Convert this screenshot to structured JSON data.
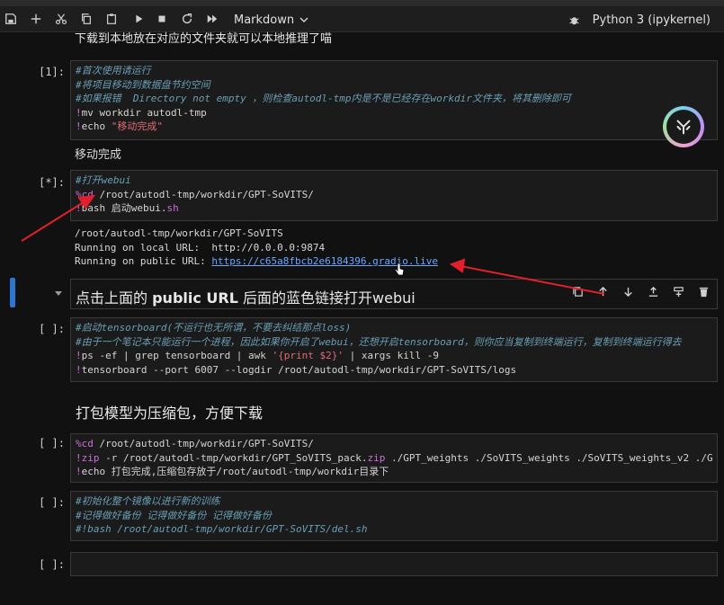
{
  "colors": {
    "accent": "#2a78d4",
    "annotation_arrow": "#e0202a",
    "link": "#6aa7ff"
  },
  "toolbar": {
    "icons": [
      "save-icon",
      "add-cell-icon",
      "cut-icon",
      "copy-icon",
      "paste-icon",
      "run-icon",
      "stop-icon",
      "restart-icon",
      "run-all-icon"
    ],
    "cell_type": "Markdown",
    "kernel": "Python 3 (ipykernel)"
  },
  "top_text": "下载到本地放在对应的文件夹就可以本地推理了喵",
  "cells": {
    "c1": {
      "prompt": "[1]:",
      "line1": "#首次使用请运行",
      "line2": "#将项目移动到数据盘节约空间",
      "line3": "#如果报错  Directory not empty ，则检查autodl-tmp内是不是已经存在workdir文件夹，将其删除即可",
      "line4_bang": "!",
      "line4": "mv workdir autodl-tmp",
      "line5_bang": "!",
      "line5_cmd": "echo ",
      "line5_str": "\"移动完成\"",
      "output": "移动完成"
    },
    "c2": {
      "prompt": "[*]:",
      "line1": "#打开webui",
      "line2_mag": "%cd",
      "line2": " /root/autodl-tmp/workdir/GPT-SoVITS/",
      "line3_bang": "!",
      "line3": "bash 启动webui.",
      "line3_ext": "sh",
      "out1": "/root/autodl-tmp/workdir/GPT-SoVITS",
      "out2": "Running on local URL:  http://0.0.0.0:9874",
      "out3_pre": "Running on public URL: ",
      "out3_link": "https://c65a8fbcb2e6184396.gradio.live"
    },
    "md1": {
      "pre": "点击上面的 ",
      "bold": "public URL",
      "post": " 后面的蓝色链接打开webui"
    },
    "c3": {
      "prompt": "[ ]:",
      "line1": "#启动tensorboard(不运行也无所谓，不要去纠结那点loss)",
      "line2": "#由于一个笔记本只能运行一个进程，因此如果你开启了webui，还想开启tensorboard，则你应当复制到终端运行，复制到终端运行得去",
      "line3_bang": "!",
      "line3_a": "ps -ef | grep tensorboard | awk ",
      "line3_str": "'{print $2}'",
      "line3_b": " | xargs kill -9",
      "line4_bang": "!",
      "line4": "tensorboard --port 6007 --logdir /root/autodl-tmp/workdir/GPT-SoVITS/logs"
    },
    "md2": "打包模型为压缩包，方便下载",
    "c4": {
      "prompt": "[ ]:",
      "line1_mag": "%cd",
      "line1": " /root/autodl-tmp/workdir/GPT-SoVITS/",
      "line2_bang": "!",
      "line2_kw": "zip",
      "line2": " -r /root/autodl-tmp/workdir/GPT_SoVITS_pack.",
      "line2_ext": "zip",
      "line2_rest": " ./GPT_weights ./SoVITS_weights ./SoVITS_weights_v2 ./G",
      "line3_bang": "!",
      "line3": "echo 打包完成,压缩包存放于/root/autodl-tmp/workdir目录下"
    },
    "c5": {
      "prompt": "[ ]:",
      "line1": "#初始化整个镜像以进行新的训练",
      "line2": "#记得做好备份 记得做好备份 记得做好备份",
      "line3": "#!bash /root/autodl-tmp/workdir/GPT-SoVITS/del.sh"
    },
    "c6": {
      "prompt": "[ ]:"
    }
  }
}
